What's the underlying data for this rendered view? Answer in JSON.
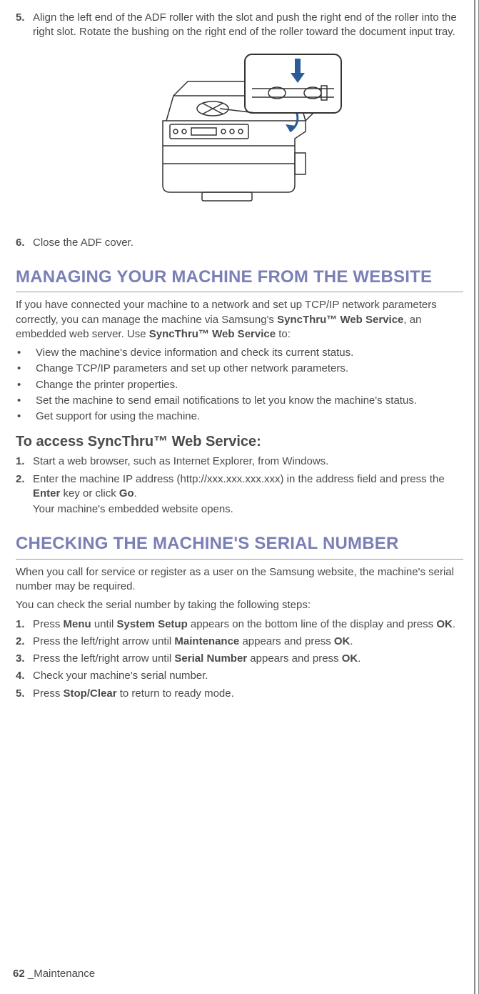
{
  "step5": {
    "num": "5.",
    "text": "Align the left end of the ADF roller with the slot and push the right end of the roller into the right slot. Rotate the bushing on the right end of the roller toward the document input tray."
  },
  "step6": {
    "num": "6.",
    "text": "Close the ADF cover."
  },
  "section1": {
    "title": "MANAGING YOUR MACHINE FROM THE WEBSITE",
    "intro_pre": "If you have connected your machine to a network and set up TCP/IP network parameters correctly, you can manage the machine via Samsung's ",
    "intro_b1": "SyncThru™ Web Service",
    "intro_mid": ", an embedded web server. Use ",
    "intro_b2": "SyncThru™ Web Service",
    "intro_post": " to:",
    "bullets": [
      "View the machine's device information and check its current status.",
      "Change TCP/IP parameters and set up other network parameters.",
      "Change the printer properties.",
      "Set the machine to send email notifications to let you know the machine's status.",
      "Get support for using the machine."
    ],
    "sub_title": "To access SyncThru™ Web Service:",
    "s1": {
      "num": "1.",
      "text": "Start a web browser, such as Internet Explorer, from Windows."
    },
    "s2": {
      "num": "2.",
      "pre": "Enter the machine IP address (http://xxx.xxx.xxx.xxx) in the address field and press the ",
      "b1": "Enter",
      "mid": " key or click ",
      "b2": "Go",
      "post": ".",
      "sub": "Your machine's embedded website opens."
    }
  },
  "section2": {
    "title": "CHECKING THE MACHINE'S SERIAL NUMBER",
    "intro1": "When you call for service or register as a user on the Samsung website, the machine's serial number may be required.",
    "intro2": "You can check the serial number by taking the following steps:",
    "s1": {
      "num": "1.",
      "pre": "Press ",
      "b1": "Menu",
      "mid1": " until ",
      "b2": "System Setup",
      "mid2": " appears on the bottom line of the display and press ",
      "b3": "OK",
      "post": "."
    },
    "s2": {
      "num": "2.",
      "pre": "Press the left/right arrow until ",
      "b1": "Maintenance",
      "mid": " appears and press ",
      "b2": "OK",
      "post": "."
    },
    "s3": {
      "num": "3.",
      "pre": "Press the left/right arrow until ",
      "b1": "Serial Number",
      "mid": " appears and press ",
      "b2": "OK",
      "post": "."
    },
    "s4": {
      "num": "4.",
      "text": "Check your machine's serial number."
    },
    "s5": {
      "num": "5.",
      "pre": "Press ",
      "b1": "Stop/Clear",
      "post": " to return to ready mode."
    }
  },
  "footer": {
    "page": "62",
    "label": "_Maintenance"
  }
}
